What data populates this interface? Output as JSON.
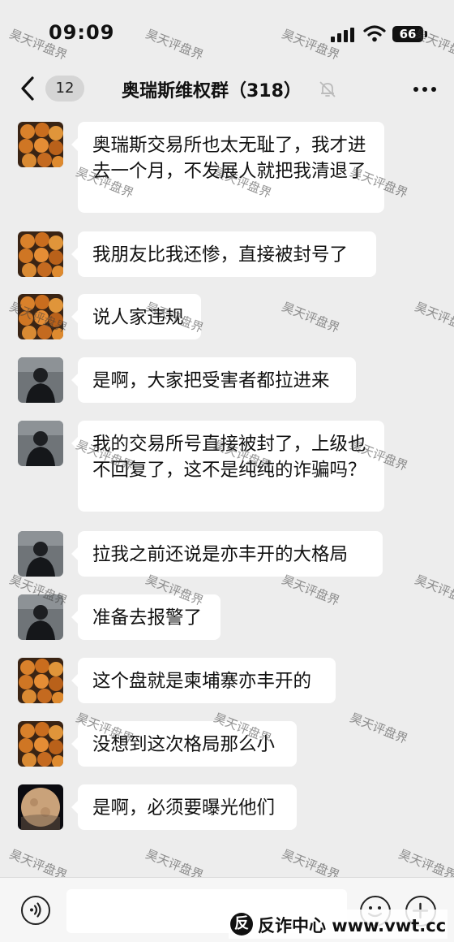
{
  "status_bar": {
    "time": "09:09",
    "battery": "66"
  },
  "nav": {
    "unread_count": "12",
    "title": "奥瑞斯维权群（318）"
  },
  "messages": [
    {
      "avatar": "orange-food-avatar",
      "text": "奥瑞斯交易所也太无耻了，我才进去一个月，不发展人就把我清退了"
    },
    {
      "avatar": "orange-food-avatar",
      "text": "我朋友比我还惨，直接被封号了"
    },
    {
      "avatar": "orange-food-avatar",
      "text": "说人家违规"
    },
    {
      "avatar": "dark-man-avatar",
      "text": "是啊，大家把受害者都拉进来"
    },
    {
      "avatar": "dark-man-avatar",
      "text": "我的交易所号直接被封了，上级也不回复了，这不是纯纯的诈骗吗？"
    },
    {
      "avatar": "dark-man-avatar",
      "text": "拉我之前还说是亦丰开的大格局"
    },
    {
      "avatar": "dark-man-avatar",
      "text": "准备去报警了"
    },
    {
      "avatar": "orange-food-avatar",
      "text": "这个盘就是柬埔寨亦丰开的"
    },
    {
      "avatar": "orange-food-avatar",
      "text": "没想到这次格局那么小"
    },
    {
      "avatar": "moon-avatar",
      "text": "是啊，必须要曝光他们"
    }
  ],
  "watermark_text": "昊天评盘界",
  "brand": {
    "mark": "反",
    "text": "反诈中心 www.vwt.cc"
  },
  "colors": {
    "background": "#ededed",
    "bubble": "#ffffff",
    "text": "#111111",
    "input_bar": "#f6f6f6"
  },
  "icons": [
    "back-icon",
    "mute-icon",
    "more-icon",
    "voice-icon",
    "emoji-icon",
    "plus-icon"
  ]
}
